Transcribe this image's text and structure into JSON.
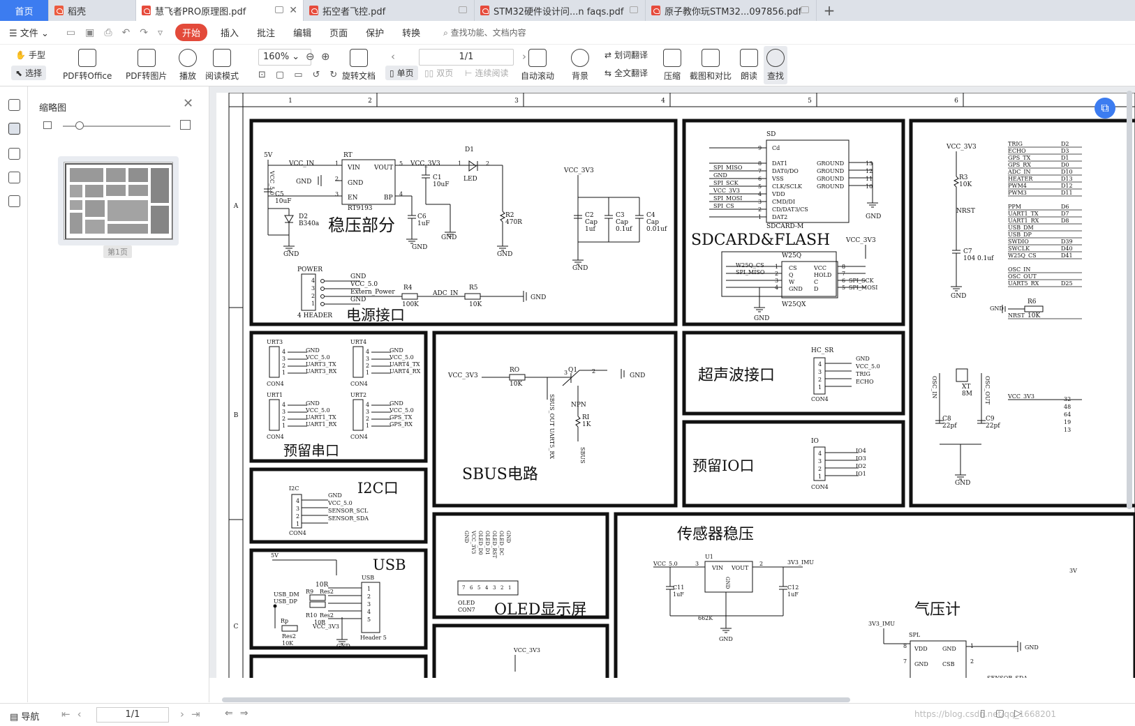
{
  "tabs": [
    {
      "label": "首页"
    },
    {
      "label": "稻壳"
    },
    {
      "label": "慧飞者PRO原理图.pdf"
    },
    {
      "label": "拓空者飞控.pdf"
    },
    {
      "label": "STM32硬件设计问...n faqs.pdf"
    },
    {
      "label": "原子教你玩STM32...097856.pdf"
    }
  ],
  "menu": {
    "file": "文件",
    "items": [
      "开始",
      "插入",
      "批注",
      "编辑",
      "页面",
      "保护",
      "转换"
    ],
    "search": "查找功能、文档内容"
  },
  "toolbar": {
    "hand": "手型",
    "select": "选择",
    "pdf_to_office": "PDF转Office",
    "pdf_to_image": "PDF转图片",
    "play": "播放",
    "read_mode": "阅读模式",
    "zoom": "160%",
    "rotate": "旋转文档",
    "page": "1/1",
    "single": "单页",
    "double": "双页",
    "continuous": "连续阅读",
    "auto_scroll": "自动滚动",
    "background": "背景",
    "translate": "划词翻译",
    "full_translate": "全文翻译",
    "compress": "压缩",
    "compare": "截图和对比",
    "read_aloud": "朗读",
    "find": "查找"
  },
  "thumbnail": {
    "title": "缩略图",
    "page_label": "第1页"
  },
  "status": {
    "nav": "导航",
    "page": "1/1",
    "watermark": "https://blog.csdn.net/qq_1668201"
  },
  "schematic": {
    "col_numbers": [
      "1",
      "2",
      "3",
      "4",
      "5",
      "6"
    ],
    "row_letters": [
      "A",
      "B",
      "C"
    ],
    "blocks": {
      "power_reg": "稳压部分",
      "power_if": "电源接口",
      "sdcard": "SDCARD&FLASH",
      "serial": "预留串口",
      "sbus": "SBUS电路",
      "ultrasonic": "超声波接口",
      "io": "预留IO口",
      "i2c": "I2C口",
      "oled": "OLED显示屏",
      "usb": "USB",
      "sensor_reg": "传感器稳压",
      "baro": "气压计"
    },
    "texts": {
      "5v": "5V",
      "vcc_in": "VCC_IN",
      "rt": "RT",
      "vin": "VIN",
      "vout": "VOUT",
      "gnd": "GND",
      "en": "EN",
      "bp": "BP",
      "rt9193": "RT9193",
      "vcc_3v3": "VCC_3V3",
      "c1": "C1",
      "10uf": "10uF",
      "d1": "D1",
      "led": "LED",
      "c5": "C5",
      "10uf2": "10uF",
      "vcc5": "VCC_5.0",
      "d2": "D2",
      "b340a": "B340a",
      "c6": "C6",
      "1uf": "1uF",
      "r2": "R2",
      "470r": "470R",
      "c2": "C2",
      "c3": "C3",
      "c4": "C4",
      "cap": "Cap",
      "1uf2": "1uf",
      "01uf": "0.1uf",
      "001uf": "0.01uf",
      "power": "POWER",
      "header4": "4 HEADER",
      "extern_power": "Extern_Power",
      "r4": "R4",
      "100k": "100K",
      "adc_in": "ADC_IN",
      "r5": "R5",
      "10k": "10K",
      "sd": "SD",
      "cd": "Cd",
      "dat1": "DAT1",
      "dat0": "DAT0/DO",
      "vss": "VSS",
      "clk": "CLK/SCLK",
      "vdd": "VDD",
      "cmd": "CMD/DI",
      "cd3": "CD/DAT3/CS",
      "dat2": "DAT2",
      "ground": "GROUND",
      "sdcard_m": "SDCARD-M",
      "spi_miso": "SPI_MISO",
      "spi_sck": "SPI_SCK",
      "spi_mosi": "SPI_MOSI",
      "spi_cs": "SPI_CS",
      "w25q": "W25Q",
      "w25qx": "W25QX",
      "w25q_cs": "W25Q_CS",
      "cs": "CS",
      "q": "Q",
      "w": "W",
      "vcc": "VCC",
      "hold": "HOLD",
      "c": "C",
      "d": "D",
      "urt3": "URT3",
      "urt4": "URT4",
      "urt1": "URT1",
      "urt2": "URT2",
      "con4": "CON4",
      "uart3_tx": "UART3_TX",
      "uart3_rx": "UART3_RX",
      "uart4_tx": "UART4_TX",
      "uart4_rx": "UART4_RX",
      "uart1_tx": "UART1_TX",
      "uart1_rx": "UART1_RX",
      "gps_tx": "GPS_TX",
      "gps_rx": "GPS_RX",
      "ro": "RO",
      "q1": "Q1",
      "npn": "NPN",
      "ri": "RI",
      "1k": "1K",
      "sbus_out": "SBUS_OUT UART5_RX",
      "sbus_sig": "SBUS",
      "hc_sr": "HC_SR",
      "trig": "TRIG",
      "echo": "ECHO",
      "io": "IO",
      "io4": "IO4",
      "io3": "IO3",
      "io2": "IO2",
      "io1": "IO1",
      "i2c": "I2C",
      "sensor_scl": "SENSOR_SCL",
      "sensor_sda": "SENSOR_SDA",
      "oled": "OLED",
      "con7": "CON7",
      "r9": "R9",
      "10r": "10R",
      "res2": "Res2",
      "usb_dm": "USB_DM",
      "usb_dp": "USB_DP",
      "r10": "R10",
      "rp": "Rp",
      "header5": "Header 5",
      "usb": "USB",
      "sv": "5V",
      "pwm": "PWM",
      "u1": "U1",
      "c11": "C11",
      "c12": "C12",
      "662k": "662K",
      "3v3_imu": "3V3_IMU",
      "spl": "SPL",
      "csb": "CSB",
      "vcc_3v3b": "VCC_3V3",
      "mcu_vcc": "VCC_3V3",
      "r3": "R3",
      "nrst": "NRST",
      "c7": "C7",
      "104": "104 0.1uf",
      "xt": "XT",
      "8m": "8M",
      "c8": "C8",
      "c9": "C9",
      "22pf": "22pf",
      "osc_in": "OSC_IN",
      "osc_out": "OSC_OUT",
      "r6": "R6",
      "mcu_pins": [
        "TRIG",
        "ECHO",
        "GPS_TX",
        "GPS_RX",
        "ADC_IN",
        "HEATER",
        "PWM4",
        "PWM3",
        "PPM",
        "UART1_TX",
        "UART1_RX",
        "USB_DM",
        "USB_DP",
        "SWDIO",
        "SWCLK",
        "W25Q_CS",
        "OSC_IN",
        "OSC_OUT",
        "UART5_RX",
        "NRST"
      ],
      "mcu_ports": [
        "D2",
        "D3",
        "D1",
        "D0",
        "D10",
        "D13",
        "D12",
        "D11",
        "D6",
        "D7",
        "D8",
        "",
        "",
        "D39",
        "D40",
        "D41",
        "",
        "",
        "D25",
        ""
      ]
    }
  }
}
